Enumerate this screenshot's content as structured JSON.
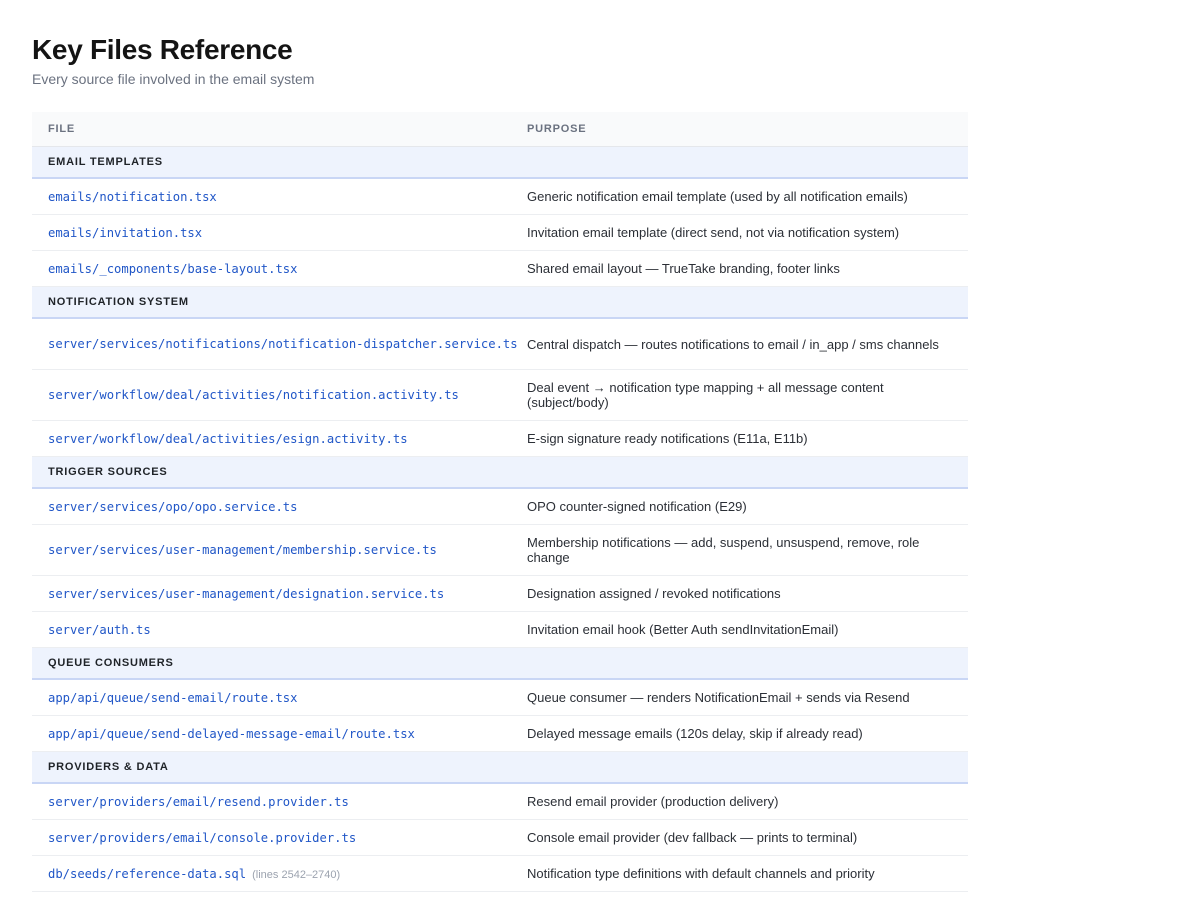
{
  "header": {
    "title": "Key Files Reference",
    "subtitle": "Every source file involved in the email system"
  },
  "table": {
    "columns": [
      "FILE",
      "PURPOSE"
    ],
    "sections": [
      {
        "label": "EMAIL TEMPLATES",
        "rows": [
          {
            "file": "emails/notification.tsx",
            "note": "",
            "purpose": "Generic notification email template (used by all notification emails)"
          },
          {
            "file": "emails/invitation.tsx",
            "note": "",
            "purpose": "Invitation email template (direct send, not via notification system)"
          },
          {
            "file": "emails/_components/base-layout.tsx",
            "note": "",
            "purpose": "Shared email layout — TrueTake branding, footer links"
          }
        ]
      },
      {
        "label": "NOTIFICATION SYSTEM",
        "rows": [
          {
            "file": "server/services/notifications/notification-dispatcher.service.ts",
            "note": "",
            "purpose": "Central dispatch — routes notifications to email / in_app / sms channels"
          },
          {
            "file": "server/workflow/deal/activities/notification.activity.ts",
            "note": "",
            "purpose": "Deal event → notification type mapping + all message content (subject/body)"
          },
          {
            "file": "server/workflow/deal/activities/esign.activity.ts",
            "note": "",
            "purpose": "E-sign signature ready notifications (E11a, E11b)"
          }
        ]
      },
      {
        "label": "TRIGGER SOURCES",
        "rows": [
          {
            "file": "server/services/opo/opo.service.ts",
            "note": "",
            "purpose": "OPO counter-signed notification (E29)"
          },
          {
            "file": "server/services/user-management/membership.service.ts",
            "note": "",
            "purpose": "Membership notifications — add, suspend, unsuspend, remove, role change"
          },
          {
            "file": "server/services/user-management/designation.service.ts",
            "note": "",
            "purpose": "Designation assigned / revoked notifications"
          },
          {
            "file": "server/auth.ts",
            "note": "",
            "purpose": "Invitation email hook (Better Auth sendInvitationEmail)"
          }
        ]
      },
      {
        "label": "QUEUE CONSUMERS",
        "rows": [
          {
            "file": "app/api/queue/send-email/route.tsx",
            "note": "",
            "purpose": "Queue consumer — renders NotificationEmail + sends via Resend"
          },
          {
            "file": "app/api/queue/send-delayed-message-email/route.tsx",
            "note": "",
            "purpose": "Delayed message emails (120s delay, skip if already read)"
          }
        ]
      },
      {
        "label": "PROVIDERS & DATA",
        "rows": [
          {
            "file": "server/providers/email/resend.provider.ts",
            "note": "",
            "purpose": "Resend email provider (production delivery)"
          },
          {
            "file": "server/providers/email/console.provider.ts",
            "note": "",
            "purpose": "Console email provider (dev fallback — prints to terminal)"
          },
          {
            "file": "db/seeds/reference-data.sql",
            "note": "(lines 2542–2740)",
            "purpose": "Notification type definitions with default channels and priority"
          }
        ]
      }
    ]
  }
}
